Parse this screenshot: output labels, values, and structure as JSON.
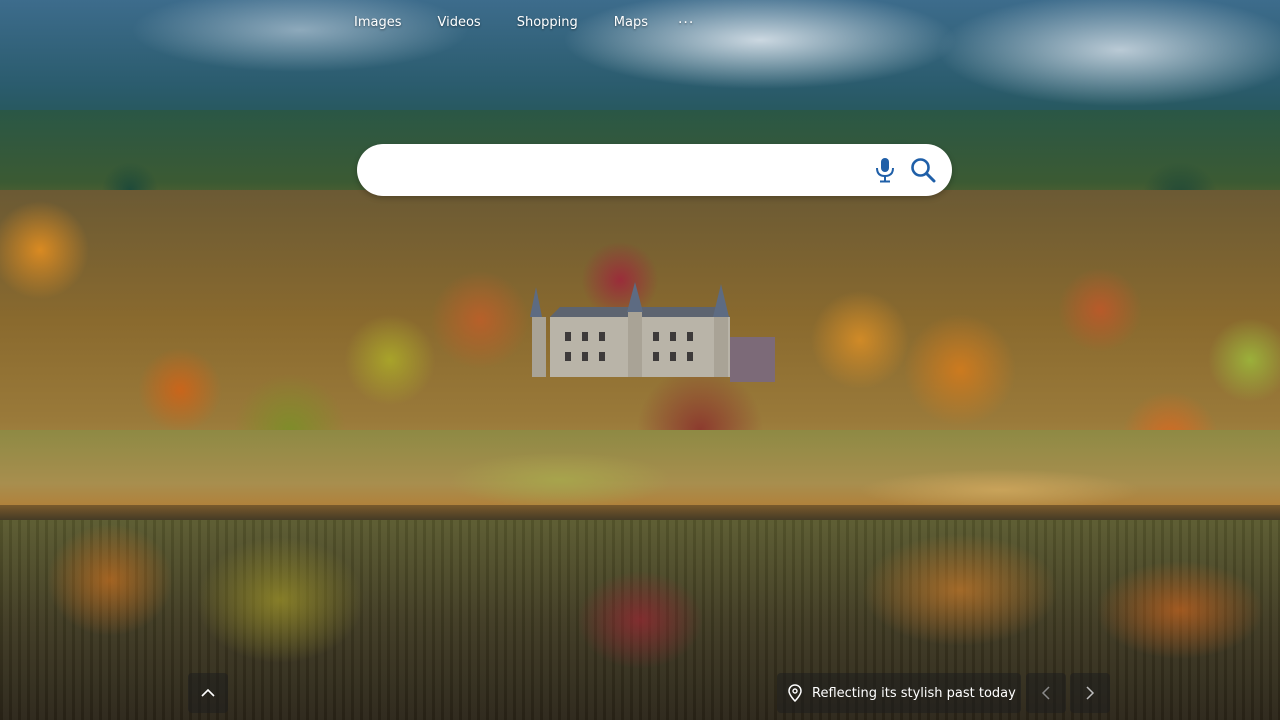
{
  "nav": {
    "items": [
      {
        "label": "Images"
      },
      {
        "label": "Videos"
      },
      {
        "label": "Shopping"
      },
      {
        "label": "Maps"
      }
    ],
    "more_label": "···"
  },
  "search": {
    "value": "",
    "placeholder": "",
    "mic_icon": "microphone-icon",
    "search_icon": "search-icon"
  },
  "caption": {
    "icon": "location-pin-icon",
    "text": "Reflecting its stylish past today"
  },
  "controls": {
    "scroll_up_icon": "chevron-up-icon",
    "prev_icon": "chevron-left-icon",
    "next_icon": "chevron-right-icon"
  },
  "colors": {
    "search_icon_color": "#1f5fa8",
    "overlay_bg": "rgba(30,30,30,0.55)"
  }
}
